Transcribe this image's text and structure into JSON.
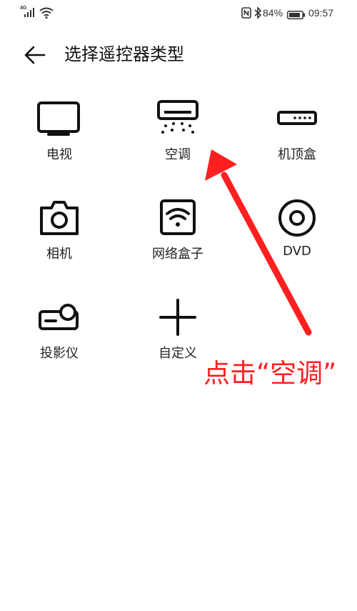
{
  "status_bar": {
    "network": "4G",
    "battery": "84%",
    "time": "09:57"
  },
  "header": {
    "title": "选择遥控器类型"
  },
  "devices": [
    {
      "label": "电视",
      "icon": "tv-icon"
    },
    {
      "label": "空调",
      "icon": "air-conditioner-icon"
    },
    {
      "label": "机顶盒",
      "icon": "set-top-box-icon"
    },
    {
      "label": "相机",
      "icon": "camera-icon"
    },
    {
      "label": "网络盒子",
      "icon": "network-box-icon"
    },
    {
      "label": "DVD",
      "icon": "dvd-icon"
    },
    {
      "label": "投影仪",
      "icon": "projector-icon"
    },
    {
      "label": "自定义",
      "icon": "plus-icon"
    }
  ],
  "annotation": {
    "text": "点击“空调”",
    "color": "#ff1f1f"
  }
}
